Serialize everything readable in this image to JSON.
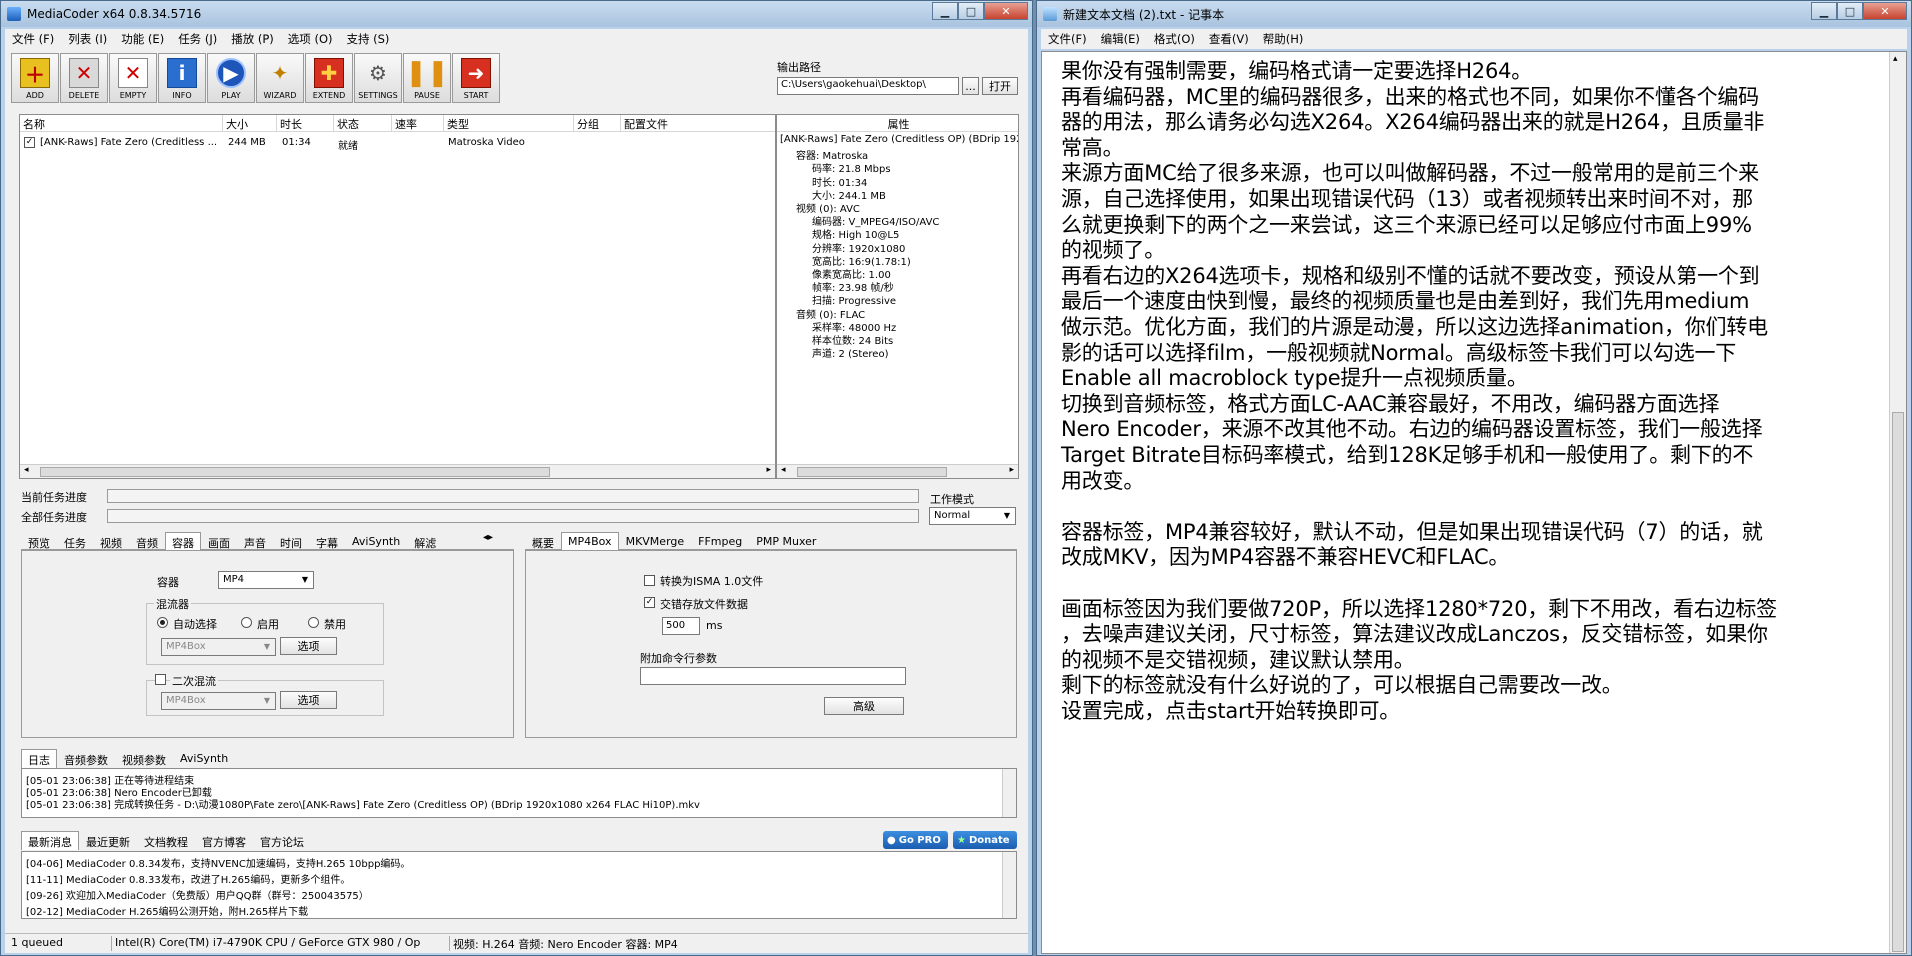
{
  "mediacoder": {
    "title": "MediaCoder x64 0.8.34.5716",
    "menu": [
      "文件 (F)",
      "列表 (I)",
      "功能 (E)",
      "任务 (J)",
      "播放 (P)",
      "选项 (O)",
      "支持 (S)"
    ],
    "toolbar": [
      {
        "label": "ADD",
        "icon": "add-icon"
      },
      {
        "label": "DELETE",
        "icon": "delete-icon"
      },
      {
        "label": "EMPTY",
        "icon": "empty-icon"
      },
      {
        "label": "INFO",
        "icon": "info-icon"
      },
      {
        "label": "PLAY",
        "icon": "play-icon"
      },
      {
        "label": "WIZARD",
        "icon": "wizard-icon"
      },
      {
        "label": "EXTEND",
        "icon": "extend-icon"
      },
      {
        "label": "SETTINGS",
        "icon": "settings-icon"
      },
      {
        "label": "PAUSE",
        "icon": "pause-icon"
      },
      {
        "label": "START",
        "icon": "start-icon"
      }
    ],
    "output": {
      "label": "输出路径",
      "path": "C:\\Users\\gaokehuai\\Desktop\\",
      "browse": "...",
      "open": "打开"
    },
    "file_list": {
      "columns": [
        "名称",
        "大小",
        "时长",
        "状态",
        "速率",
        "类型",
        "分组",
        "配置文件"
      ],
      "rows": [
        {
          "name": "[ANK-Raws] Fate Zero (Creditless ...",
          "size": "244 MB",
          "duration": "01:34",
          "status": "就绪",
          "rate": "",
          "type": "Matroska Video",
          "group": "",
          "profile": ""
        }
      ]
    },
    "properties": {
      "header": "属性",
      "lines": [
        {
          "text": "[ANK-Raws] Fate Zero (Creditless OP) (BDrip 1920",
          "indent": 0
        },
        {
          "text": "容器: Matroska",
          "indent": 1
        },
        {
          "text": "码率: 21.8 Mbps",
          "indent": 2
        },
        {
          "text": "时长: 01:34",
          "indent": 2
        },
        {
          "text": "大小: 244.1 MB",
          "indent": 2
        },
        {
          "text": "视频 (0): AVC",
          "indent": 1
        },
        {
          "text": "编码器: V_MPEG4/ISO/AVC",
          "indent": 2
        },
        {
          "text": "规格: High 10@L5",
          "indent": 2
        },
        {
          "text": "分辨率: 1920x1080",
          "indent": 2
        },
        {
          "text": "宽高比: 16:9(1.78:1)",
          "indent": 2
        },
        {
          "text": "像素宽高比: 1.00",
          "indent": 2
        },
        {
          "text": "帧率: 23.98 帧/秒",
          "indent": 2
        },
        {
          "text": "扫描: Progressive",
          "indent": 2
        },
        {
          "text": "音频 (0): FLAC",
          "indent": 1
        },
        {
          "text": "采样率: 48000 Hz",
          "indent": 2
        },
        {
          "text": "样本位数: 24 Bits",
          "indent": 2
        },
        {
          "text": "声道: 2 (Stereo)",
          "indent": 2
        }
      ]
    },
    "progress": {
      "current_label": "当前任务进度",
      "total_label": "全部任务进度",
      "current": 0,
      "total": 0
    },
    "work_mode": {
      "label": "工作模式",
      "value": "Normal"
    },
    "left_tabs": [
      "预览",
      "任务",
      "视频",
      "音频",
      "容器",
      "画面",
      "声音",
      "时间",
      "字幕",
      "AviSynth",
      "解滤"
    ],
    "left_tab_active": "容器",
    "container_panel": {
      "container_label": "容器",
      "container_value": "MP4",
      "muxer_group": "混流器",
      "radio_auto": "自动选择",
      "radio_enable": "启用",
      "radio_disable": "禁用",
      "muxer_value": "MP4Box",
      "options_button": "选项",
      "second_mux_label": "二次混流",
      "second_mux_value": "MP4Box",
      "second_options_button": "选项"
    },
    "right_tabs": [
      "概要",
      "MP4Box",
      "MKVMerge",
      "FFmpeg",
      "PMP Muxer"
    ],
    "right_tab_active": "MP4Box",
    "mp4box_panel": {
      "isma_label": "转换为ISMA 1.0文件",
      "isma_checked": false,
      "interleave_label": "交错存放文件数据",
      "interleave_checked": true,
      "interleave_value": "500",
      "interleave_unit": "ms",
      "cmdline_label": "附加命令行参数",
      "cmdline_value": "",
      "advanced_button": "高级"
    },
    "log_tabs": [
      "日志",
      "音频参数",
      "视频参数",
      "AviSynth"
    ],
    "log_lines": [
      "[05-01 23:06:38] 正在等待进程结束",
      "[05-01 23:06:38] Nero Encoder已卸载",
      "[05-01 23:06:38] 完成转换任务 - D:\\动漫1080P\\Fate zero\\[ANK-Raws] Fate Zero (Creditless OP) (BDrip 1920x1080 x264 FLAC Hi10P).mkv"
    ],
    "news_tabs": [
      "最新消息",
      "最近更新",
      "文档教程",
      "官方博客",
      "官方论坛"
    ],
    "go_pro": "Go PRO",
    "donate": "Donate",
    "news_lines": [
      "[04-06] MediaCoder 0.8.34发布，支持NVENC加速编码，支持H.265 10bpp编码。",
      "[11-11] MediaCoder 0.8.33发布，改进了H.265编码，更新多个组件。",
      "[09-26] 欢迎加入MediaCoder（免费版）用户QQ群（群号：250043575）",
      "[02-12] MediaCoder H.265编码公测开始，附H.265样片下载"
    ],
    "status": {
      "queued": "1 queued",
      "hardware": "Intel(R) Core(TM) i7-4790K CPU  /  GeForce GTX 980  /  Op",
      "summary": "视频: H.264  音频: Nero Encoder  容器: MP4"
    }
  },
  "notepad": {
    "title": "新建文本文档 (2).txt - 记事本",
    "menu": [
      "文件(F)",
      "编辑(E)",
      "格式(O)",
      "查看(V)",
      "帮助(H)"
    ],
    "lines": [
      "果你没有强制需要，编码格式请一定要选择H264。",
      "再看编码器，MC里的编码器很多，出来的格式也不同，如果你不懂各个编码",
      "器的用法，那么请务必勾选X264。X264编码器出来的就是H264，且质量非",
      "常高。",
      "来源方面MC给了很多来源，也可以叫做解码器，不过一般常用的是前三个来",
      "源，自己选择使用，如果出现错误代码（13）或者视频转出来时间不对，那",
      "么就更换剩下的两个之一来尝试，这三个来源已经可以足够应付市面上99%",
      "的视频了。",
      "再看右边的X264选项卡，规格和级别不懂的话就不要改变，预设从第一个到",
      "最后一个速度由快到慢，最终的视频质量也是由差到好，我们先用medium",
      "做示范。优化方面，我们的片源是动漫，所以这边选择animation，你们转电",
      "影的话可以选择film，一般视频就Normal。高级标签卡我们可以勾选一下",
      "Enable all macroblock type提升一点视频质量。",
      "切换到音频标签，格式方面LC-AAC兼容最好，不用改，编码器方面选择",
      "Nero Encoder，来源不改其他不动。右边的编码器设置标签，我们一般选择",
      "Target Bitrate目标码率模式，给到128K足够手机和一般使用了。剩下的不",
      "用改变。",
      "",
      "容器标签，MP4兼容较好，默认不动，但是如果出现错误代码（7）的话，就",
      "改成MKV，因为MP4容器不兼容HEVC和FLAC。",
      "",
      "画面标签因为我们要做720P，所以选择1280*720，剩下不用改，看右边标签",
      "，去噪声建议关闭，尺寸标签，算法建议改成Lanczos，反交错标签，如果你",
      "的视频不是交错视频，建议默认禁用。",
      "剩下的标签就没有什么好说的了，可以根据自己需要改一改。",
      "设置完成，点击start开始转换即可。"
    ]
  }
}
